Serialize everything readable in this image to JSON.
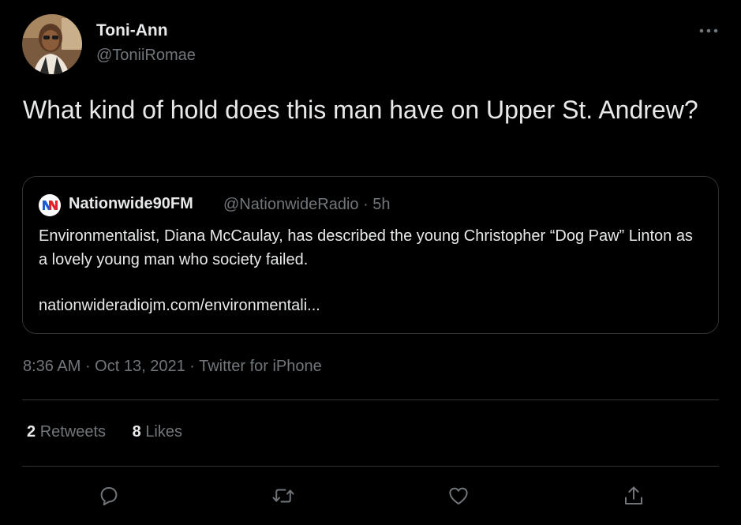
{
  "tweet": {
    "author": {
      "name": "Toni-Ann",
      "handle": "@ToniiRomae"
    },
    "text": "What kind of hold does this man have on Upper St. Andrew?",
    "quoted": {
      "name": "Nationwide90FM",
      "handle": "@NationwideRadio",
      "time": "5h",
      "text": "Environmentalist, Diana McCaulay, has described the young Christopher “Dog Paw” Linton as a lovely young man who society failed.",
      "link": "nationwideradiojm.com/environmentali..."
    },
    "time": "8:36 AM",
    "date": "Oct 13, 2021",
    "source": "Twitter for iPhone",
    "stats": {
      "retweets_count": "2",
      "retweets_label": "Retweets",
      "likes_count": "8",
      "likes_label": "Likes"
    }
  },
  "icons": {
    "more": "more-icon",
    "reply": "reply-icon",
    "retweet": "retweet-icon",
    "like": "like-icon",
    "share": "share-icon"
  },
  "colors": {
    "background": "#000000",
    "primary_text": "#e7e9ea",
    "secondary_text": "#71767b",
    "border": "#2f3336"
  }
}
